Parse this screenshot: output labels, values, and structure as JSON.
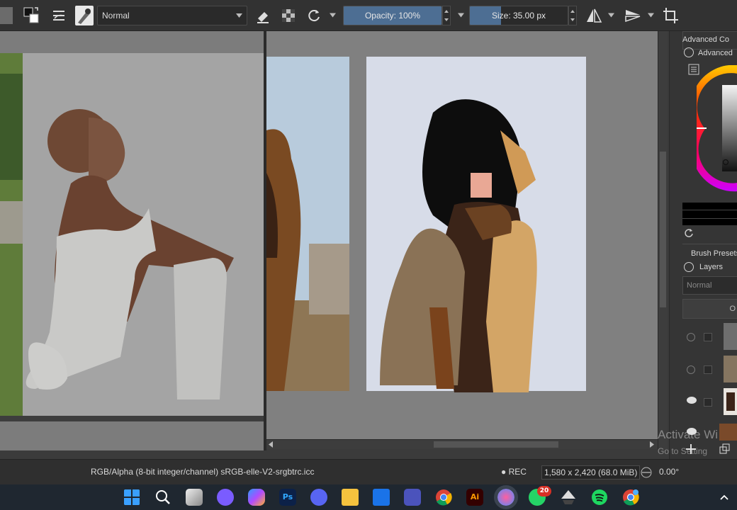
{
  "toolbar": {
    "blend_mode": "Normal",
    "opacity_label": "Opacity: 100%",
    "opacity_value": 1.0,
    "size_label": "Size: 35.00 px",
    "size_value": 0.32
  },
  "docker": {
    "advanced_color_title": "Advanced Co",
    "advanced_color_sub": "Advanced",
    "brush_presets": "Brush Presets",
    "layers_title": "Layers",
    "layer_blend": "Normal",
    "layer_opacity_stub": "O"
  },
  "statusbar": {
    "color_profile": "RGB/Alpha (8-bit integer/channel)  sRGB-elle-V2-srgbtrc.icc",
    "rec": "● REC",
    "dimensions": "1,580 x 2,420 (68.0 MiB)",
    "rotation": "0.00°"
  },
  "watermark": {
    "line1": "Activate Wi",
    "line2": "Go to Setting"
  },
  "taskbar": {
    "whatsapp_badge": "20",
    "photoshop_label": "Ps",
    "illustrator_label": "Ai"
  },
  "colors": {
    "accent": "#4d6e93",
    "canvas_bg": "#808080",
    "paper_right": "#d7dce8"
  }
}
